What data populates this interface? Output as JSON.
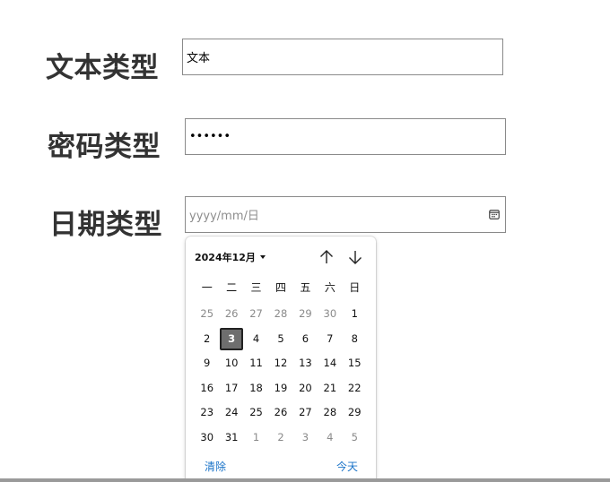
{
  "fields": {
    "text": {
      "label": "文本类型",
      "value": "文本"
    },
    "password": {
      "label": "密码类型",
      "value": "••••••"
    },
    "date": {
      "label": "日期类型",
      "placeholder": "yyyy/mm/日",
      "icon": "calendar-icon"
    }
  },
  "calendar": {
    "month_label": "2024年12月",
    "prev_icon": "arrow-up-icon",
    "next_icon": "arrow-down-icon",
    "weekdays": [
      "一",
      "二",
      "三",
      "四",
      "五",
      "六",
      "日"
    ],
    "days": [
      {
        "n": "25",
        "muted": true
      },
      {
        "n": "26",
        "muted": true
      },
      {
        "n": "27",
        "muted": true
      },
      {
        "n": "28",
        "muted": true
      },
      {
        "n": "29",
        "muted": true
      },
      {
        "n": "30",
        "muted": true
      },
      {
        "n": "1"
      },
      {
        "n": "2"
      },
      {
        "n": "3",
        "selected": true
      },
      {
        "n": "4"
      },
      {
        "n": "5"
      },
      {
        "n": "6"
      },
      {
        "n": "7"
      },
      {
        "n": "8"
      },
      {
        "n": "9"
      },
      {
        "n": "10"
      },
      {
        "n": "11"
      },
      {
        "n": "12"
      },
      {
        "n": "13"
      },
      {
        "n": "14"
      },
      {
        "n": "15"
      },
      {
        "n": "16"
      },
      {
        "n": "17"
      },
      {
        "n": "18"
      },
      {
        "n": "19"
      },
      {
        "n": "20"
      },
      {
        "n": "21"
      },
      {
        "n": "22"
      },
      {
        "n": "23"
      },
      {
        "n": "24"
      },
      {
        "n": "25"
      },
      {
        "n": "26"
      },
      {
        "n": "27"
      },
      {
        "n": "28"
      },
      {
        "n": "29"
      },
      {
        "n": "30"
      },
      {
        "n": "31"
      },
      {
        "n": "1",
        "muted": true
      },
      {
        "n": "2",
        "muted": true
      },
      {
        "n": "3",
        "muted": true
      },
      {
        "n": "4",
        "muted": true
      },
      {
        "n": "5",
        "muted": true
      }
    ],
    "clear_label": "清除",
    "today_label": "今天",
    "link_color": "#1a73c8",
    "selected_color": "#6e6e6e"
  }
}
